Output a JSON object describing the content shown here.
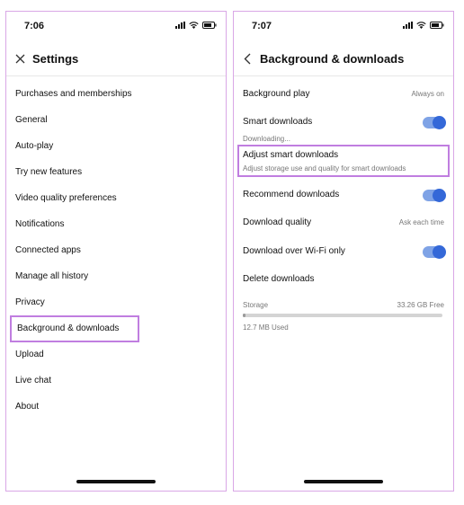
{
  "left_phone": {
    "status": {
      "time": "7:06"
    },
    "header": {
      "title": "Settings",
      "icon": "close-icon"
    },
    "menu": [
      "Purchases and memberships",
      "General",
      "Auto-play",
      "Try new features",
      "Video quality preferences",
      "Notifications",
      "Connected apps",
      "Manage all history",
      "Privacy",
      "Background & downloads",
      "Upload",
      "Live chat",
      "About"
    ],
    "highlighted_item": "Background & downloads"
  },
  "right_phone": {
    "status": {
      "time": "7:07"
    },
    "header": {
      "title": "Background & downloads",
      "icon": "back-chevron-icon"
    },
    "background_play": {
      "label": "Background play",
      "value": "Always on"
    },
    "smart_downloads": {
      "label": "Smart downloads",
      "sub": "Downloading...",
      "enabled": true
    },
    "adjust_smart_downloads": {
      "label": "Adjust smart downloads",
      "sub": "Adjust storage use and quality for smart downloads"
    },
    "recommend_downloads": {
      "label": "Recommend downloads",
      "enabled": true
    },
    "download_quality": {
      "label": "Download quality",
      "value": "Ask each time"
    },
    "download_wifi": {
      "label": "Download over Wi-Fi only",
      "enabled": true
    },
    "delete_downloads": {
      "label": "Delete downloads"
    },
    "storage": {
      "label": "Storage",
      "free": "33.26 GB Free",
      "used": "12.7 MB Used",
      "used_fraction": 0.0004
    }
  },
  "colors": {
    "highlight": "#c07ee0",
    "toggle_track": "#7fa3e6",
    "toggle_knob": "#3468d8",
    "frame": "#d9a7e6"
  }
}
